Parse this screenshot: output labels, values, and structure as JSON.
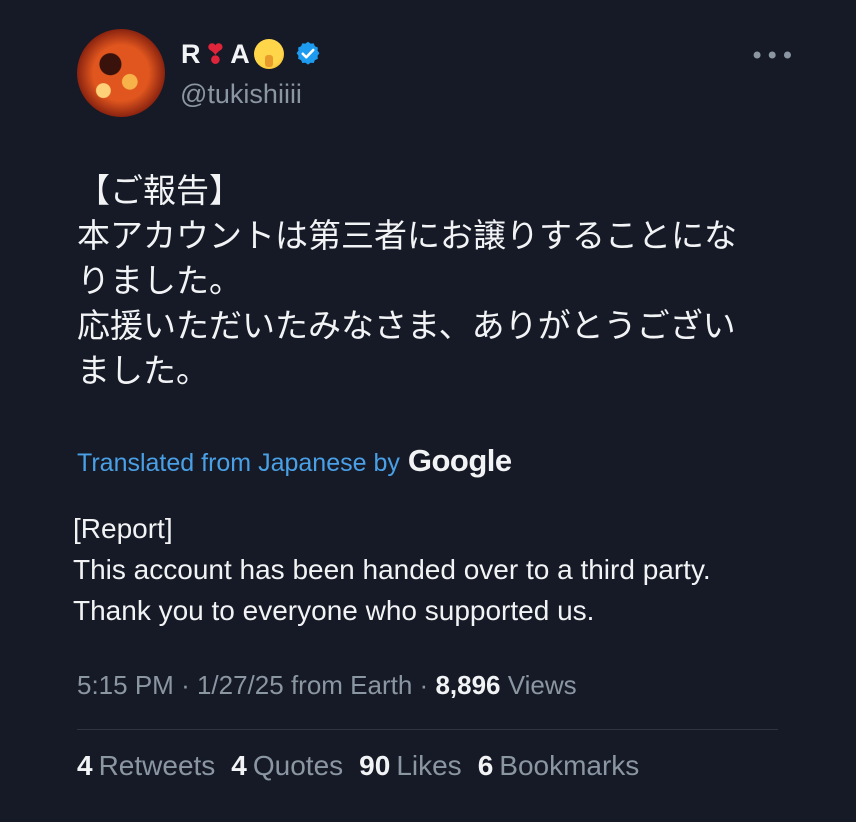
{
  "author": {
    "name_prefix": "R",
    "name_heart": "❣",
    "name_letter": "A",
    "name_emoji": "shushing-face-emoji",
    "verified": true,
    "handle": "@tukishiiii"
  },
  "tweet": {
    "japanese_lines": [
      "【ご報告】",
      "本アカウントは第三者にお譲りすることにな",
      "りました。",
      "応援いただいたみなさま、ありがとうござい",
      "ました。"
    ],
    "translated_label": "Translated from Japanese by",
    "translated_brand": "Google",
    "english_lines": [
      "[Report]",
      "This account has been handed over to a third party.",
      "Thank you to everyone who supported us."
    ]
  },
  "meta": {
    "time": "5:15 PM",
    "date": "1/27/25",
    "location": "from Earth",
    "views_count": "8,896",
    "views_label": "Views"
  },
  "stats": {
    "retweets_count": "4",
    "retweets_label": "Retweets",
    "quotes_count": "4",
    "quotes_label": "Quotes",
    "likes_count": "90",
    "likes_label": "Likes",
    "bookmarks_count": "6",
    "bookmarks_label": "Bookmarks"
  },
  "colors": {
    "background": "#161a26",
    "link_blue": "#4aa0e6",
    "verified_blue": "#1d9bf0",
    "muted": "#8b96a3"
  }
}
